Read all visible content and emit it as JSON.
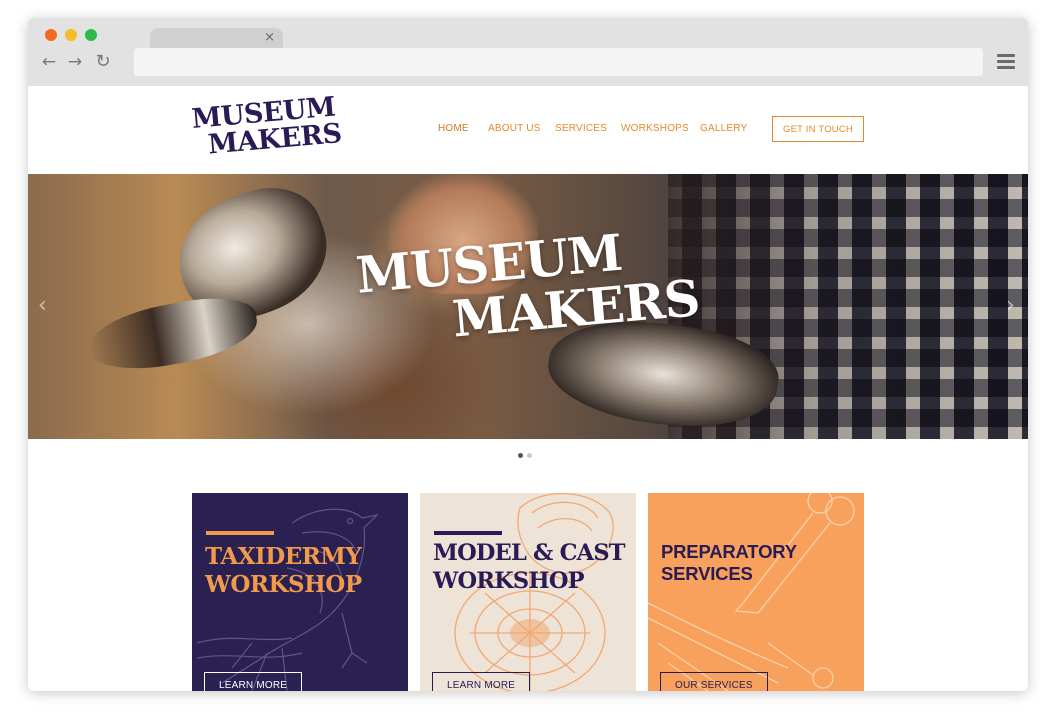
{
  "browser": {
    "tab_close": "×",
    "icons": [
      "back-arrow-icon",
      "forward-arrow-icon",
      "reload-icon",
      "hamburger-menu-icon",
      "close-icon"
    ],
    "back_glyph": "←",
    "forward_glyph": "→",
    "reload_glyph": "↻"
  },
  "header": {
    "logo_line1": "MUSEUM",
    "logo_line2": "MAKERS",
    "nav": [
      "HOME",
      "ABOUT US",
      "SERVICES",
      "WORKSHOPS",
      "GALLERY"
    ],
    "active_nav": "HOME",
    "cta_label": "GET IN TOUCH"
  },
  "hero": {
    "title_line1": "MUSEUM",
    "title_line2": "MAKERS",
    "prev_glyph": "‹",
    "next_glyph": "›",
    "slide_count": 2,
    "active_slide": 1
  },
  "cards": [
    {
      "title_line1": "TAXIDERMY",
      "title_line2": "WORKSHOP",
      "button": "LEARN MORE"
    },
    {
      "title_line1": "MODEL & CAST",
      "title_line2": "WORKSHOP",
      "button": "LEARN MORE"
    },
    {
      "title_line1": "PREPARATORY",
      "title_line2": "SERVICES",
      "button": "OUR SERVICES"
    }
  ],
  "colors": {
    "brand_purple": "#2a1b56",
    "brand_orange": "#e38a2c",
    "card_cream": "#ede3d6",
    "card_orange": "#f7a15c"
  }
}
